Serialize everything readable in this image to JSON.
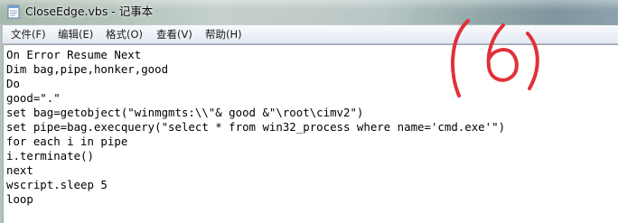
{
  "window": {
    "title": "CloseEdge.vbs - 记事本"
  },
  "menu": [
    {
      "label": "文件(F)"
    },
    {
      "label": "编辑(E)"
    },
    {
      "label": "格式(O)"
    },
    {
      "label": "查看(V)"
    },
    {
      "label": "帮助(H)"
    }
  ],
  "editor": {
    "lines": [
      "On Error Resume Next",
      "Dim bag,pipe,honker,good",
      "Do",
      "good=\".\"",
      "set bag=getobject(\"winmgmts:\\\\\"& good &\"\\root\\cimv2\")",
      "set pipe=bag.execquery(\"select * from win32_process where name='cmd.exe'\")",
      "for each i in pipe",
      "i.terminate()",
      "next",
      "wscript.sleep 5",
      "loop"
    ]
  },
  "annotation": {
    "text": "(6)",
    "color": "#e0313a"
  },
  "icons": {
    "app": "notepad-icon"
  }
}
